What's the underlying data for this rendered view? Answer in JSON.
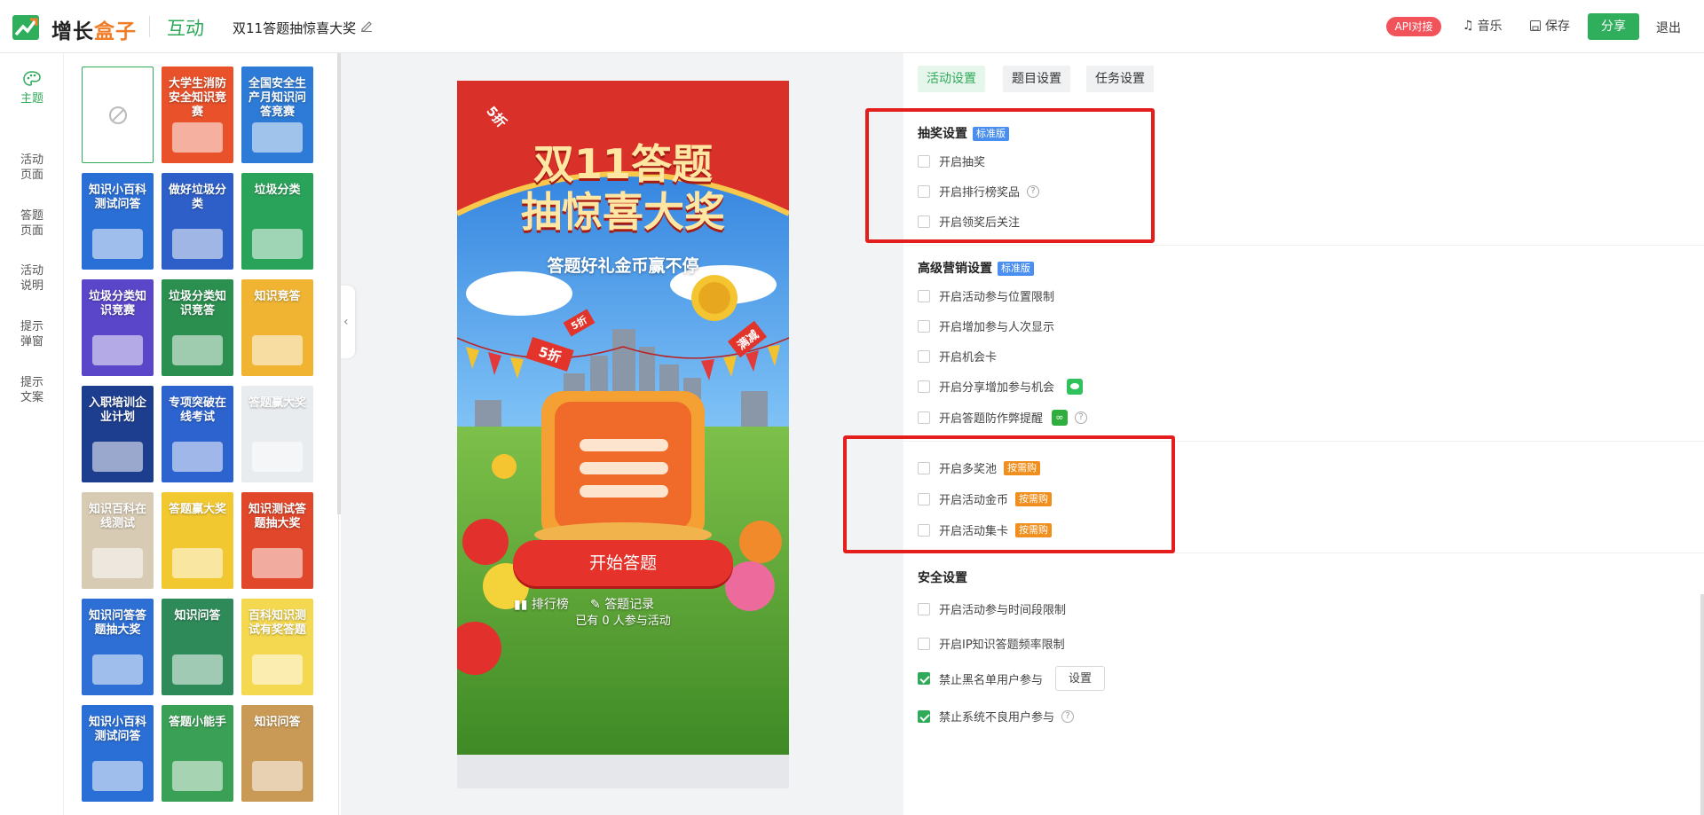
{
  "header": {
    "logo": {
      "part1": "增长",
      "part2": "盒子"
    },
    "module": "互动",
    "activity_title": "双11答题抽惊喜大奖",
    "api_badge": "API对接",
    "music": "音乐",
    "save": "保存",
    "share": "分享",
    "exit": "退出"
  },
  "leftnav": {
    "items": [
      {
        "label": "主题",
        "icon": "palette-icon",
        "active": true
      },
      {
        "label": "活动页面"
      },
      {
        "label": "答题页面"
      },
      {
        "label": "活动说明"
      },
      {
        "label": "提示弹窗"
      },
      {
        "label": "提示文案"
      }
    ]
  },
  "templates": [
    {
      "title": "",
      "bg": "#ffffff"
    },
    {
      "title": "大学生消防安全知识竞赛",
      "bg": "#e8512a"
    },
    {
      "title": "全国安全生产月知识问答竞赛",
      "bg": "#2d7bd6"
    },
    {
      "title": "知识小百科测试问答",
      "bg": "#2a6fd6"
    },
    {
      "title": "做好垃圾分类",
      "bg": "#2e5fc8"
    },
    {
      "title": "垃圾分类",
      "bg": "#2aa35a"
    },
    {
      "title": "垃圾分类知识竞赛",
      "bg": "#5a46c8"
    },
    {
      "title": "垃圾分类知识竞答",
      "bg": "#2b8f4f"
    },
    {
      "title": "知识竞答",
      "bg": "#f0b432"
    },
    {
      "title": "入职培训企业计划",
      "bg": "#1d3e8f"
    },
    {
      "title": "专项突破在线考试",
      "bg": "#2c63cf"
    },
    {
      "title": "答题赢大奖",
      "bg": "#e9ecef"
    },
    {
      "title": "知识百科在线测试",
      "bg": "#d8cbb4"
    },
    {
      "title": "答题赢大奖",
      "bg": "#f2c830"
    },
    {
      "title": "知识测试答题抽大奖",
      "bg": "#e0472b"
    },
    {
      "title": "知识问答答题抽大奖",
      "bg": "#2d6fd4"
    },
    {
      "title": "知识问答",
      "bg": "#2f8a5a"
    },
    {
      "title": "百科知识测试有奖答题",
      "bg": "#f4d84f"
    },
    {
      "title": "知识小百科测试问答",
      "bg": "#2a6fd6"
    },
    {
      "title": "答题小能手",
      "bg": "#3aa055"
    },
    {
      "title": "知识问答",
      "bg": "#c99a55"
    }
  ],
  "phone": {
    "badge": "5折",
    "title_line1": "双11答题",
    "title_line2": "抽惊喜大奖",
    "subtitle": "答题好礼金币赢不停",
    "flag1": "5折",
    "flag2": "满减",
    "start_button": "开始答题",
    "rank": "排行榜",
    "records": "答题记录",
    "participants": "已有 0 人参与活动"
  },
  "settings": {
    "tabs": [
      "活动设置",
      "题目设置",
      "任务设置"
    ],
    "lottery": {
      "title": "抽奖设置",
      "tag": "标准版",
      "options": [
        "开启抽奖",
        "开启排行榜奖品",
        "开启领奖后关注"
      ]
    },
    "marketing": {
      "title": "高级营销设置",
      "tag": "标准版",
      "options": [
        "开启活动参与位置限制",
        "开启增加参与人次显示",
        "开启机会卡",
        "开启分享增加参与机会",
        "开启答题防作弊提醒"
      ]
    },
    "paid": {
      "tag": "按需购",
      "options": [
        "开启多奖池",
        "开启活动金币",
        "开启活动集卡"
      ]
    },
    "security": {
      "title": "安全设置",
      "options": [
        "开启活动参与时间段限制",
        "开启IP知识答题频率限制",
        "禁止黑名单用户参与",
        "禁止系统不良用户参与"
      ],
      "set_button": "设置"
    }
  }
}
